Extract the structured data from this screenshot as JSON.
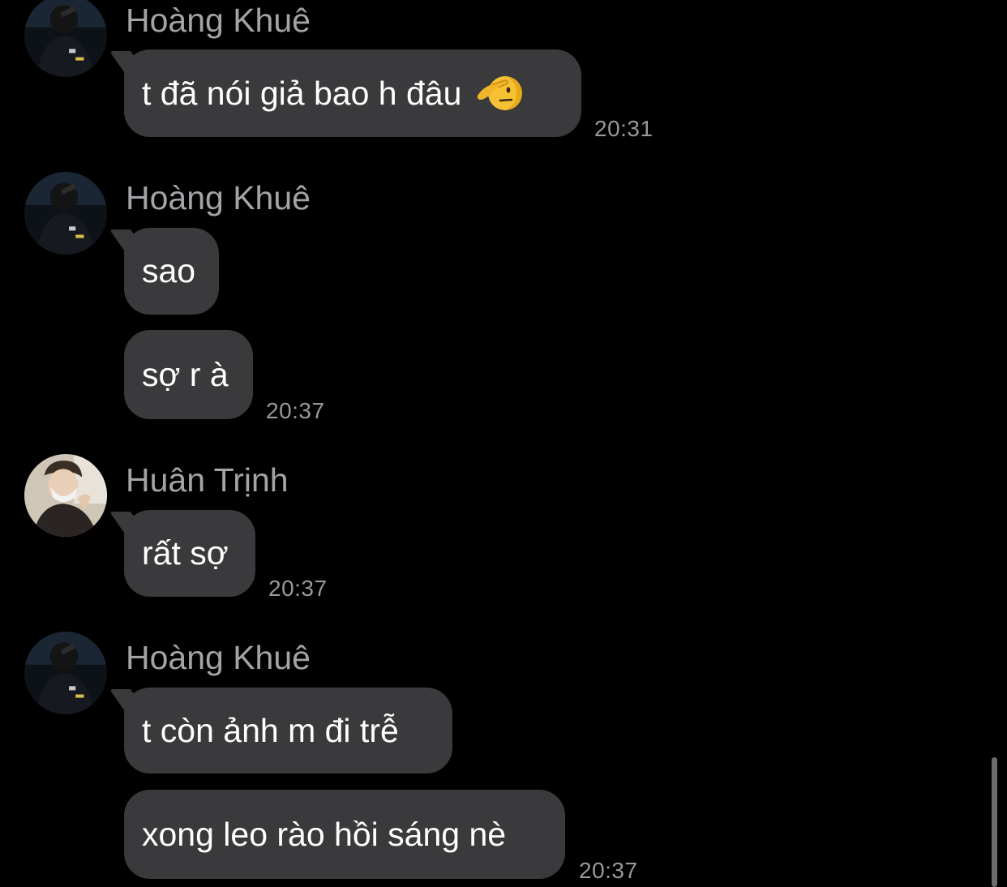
{
  "messages": [
    {
      "sender": "Hoàng Khuê",
      "avatar": "avatar-hoang-khue",
      "bubbles": [
        {
          "text": "t đã nói giả bao h đâu",
          "emoji": "saluting-face-icon"
        }
      ],
      "time": "20:31"
    },
    {
      "sender": "Hoàng Khuê",
      "avatar": "avatar-hoang-khue",
      "bubbles": [
        {
          "text": "sao"
        },
        {
          "text": "sợ r à"
        }
      ],
      "time": "20:37"
    },
    {
      "sender": "Huân Trịnh",
      "avatar": "avatar-huan-trinh",
      "bubbles": [
        {
          "text": "rất sợ"
        }
      ],
      "time": "20:37"
    },
    {
      "sender": "Hoàng Khuê",
      "avatar": "avatar-hoang-khue",
      "bubbles": [
        {
          "text": "t còn ảnh m đi trễ"
        },
        {
          "text": "xong leo rào hồi sáng nè"
        }
      ],
      "time": "20:37"
    }
  ],
  "colors": {
    "background": "#000000",
    "bubble": "#3a3a3c",
    "text": "#ffffff",
    "sender": "#a3a3a8",
    "time": "#98989d"
  }
}
